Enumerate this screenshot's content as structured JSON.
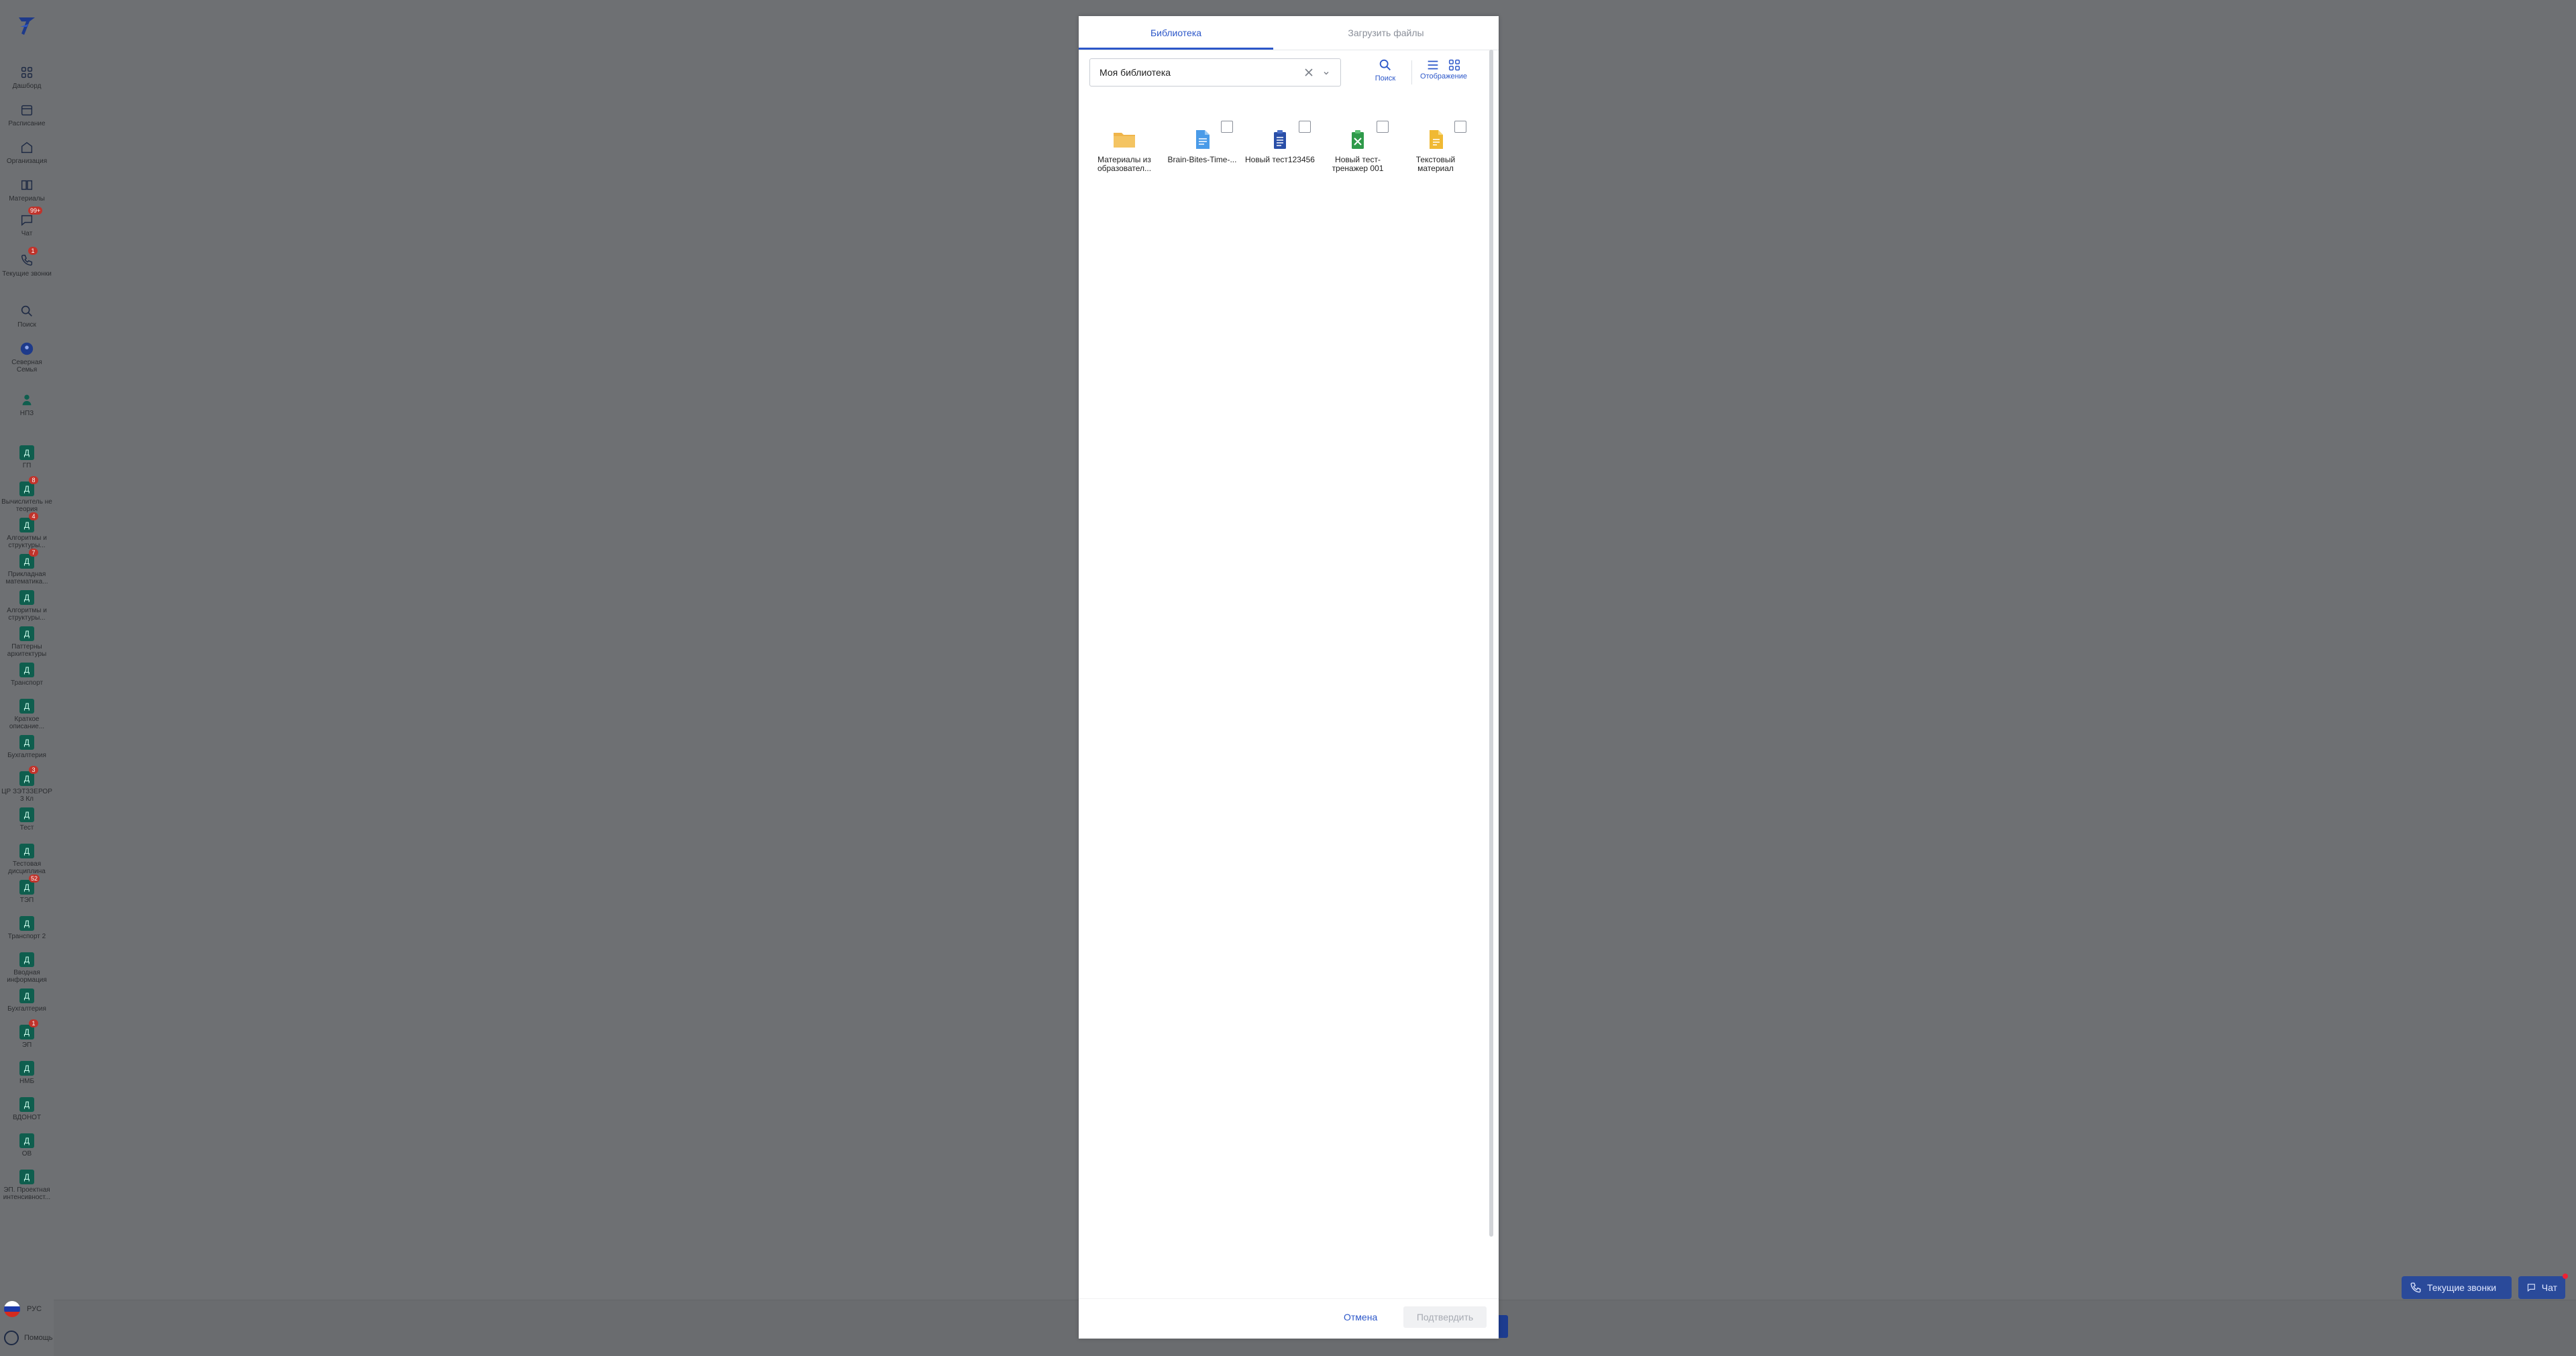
{
  "sidebar": {
    "items": [
      {
        "label": "Дашборд",
        "icon": "dashboard-icon"
      },
      {
        "label": "Расписание",
        "icon": "calendar-icon"
      },
      {
        "label": "Организация",
        "icon": "organization-icon"
      },
      {
        "label": "Материалы",
        "icon": "book-icon"
      },
      {
        "label": "Чат",
        "icon": "chat-icon",
        "badge": "99+"
      },
      {
        "label": "Текущие звонки",
        "icon": "phone-icon",
        "badge": "1"
      },
      {
        "label": "Поиск",
        "icon": "search-icon"
      },
      {
        "label": "Северная Семья",
        "icon": "group-avatar-icon"
      },
      {
        "label": "НПЗ",
        "icon": "person-icon"
      }
    ],
    "courses": [
      {
        "label": "ГП",
        "badge": ""
      },
      {
        "label": "Вычислитель не теория",
        "badge": "8"
      },
      {
        "label": "Алгоритмы и структуры...",
        "badge": "4"
      },
      {
        "label": "Прикладная математика...",
        "badge": "7"
      },
      {
        "label": "Алгоритмы и структуры...",
        "badge": ""
      },
      {
        "label": "Паттерны архитектуры",
        "badge": ""
      },
      {
        "label": "Транспорт",
        "badge": ""
      },
      {
        "label": "Краткое описание...",
        "badge": ""
      },
      {
        "label": "Бухгалтерия",
        "badge": ""
      },
      {
        "label": "ЦР ЗЭТЗЗЕРОР 3 Кл",
        "badge": "3"
      },
      {
        "label": "Тест",
        "badge": ""
      },
      {
        "label": "Тестовая дисциплина",
        "badge": ""
      },
      {
        "label": "ТЭП",
        "badge": "52"
      },
      {
        "label": "Транспорт 2",
        "badge": ""
      },
      {
        "label": "Вводная информация",
        "badge": ""
      },
      {
        "label": "Бухгалтерия",
        "badge": ""
      },
      {
        "label": "ЭП",
        "badge": "1"
      },
      {
        "label": "НМБ",
        "badge": ""
      },
      {
        "label": "ВДОНОТ",
        "badge": ""
      },
      {
        "label": "ОВ",
        "badge": ""
      },
      {
        "label": "ЭП. Проектная интенсивност...",
        "badge": ""
      }
    ],
    "lang": "РУС",
    "help": "Помощь"
  },
  "floating": {
    "calls_label": "Текущие звонки",
    "chat_label": "Чат"
  },
  "modal": {
    "tabs": [
      {
        "label": "Библиотека",
        "active": true
      },
      {
        "label": "Загрузить файлы",
        "active": false
      }
    ],
    "library_select": {
      "value": "Моя библиотека"
    },
    "tools": {
      "search_label": "Поиск",
      "view_label": "Отображение"
    },
    "files": [
      {
        "name": "Материалы из образовател...",
        "type": "folder",
        "color": "#f0b54a",
        "checkbox": false
      },
      {
        "name": "Brain-Bites-Time-...",
        "type": "document",
        "color": "#4a9be8",
        "checkbox": true
      },
      {
        "name": "Новый тест123456",
        "type": "test",
        "color": "#2a4fa8",
        "checkbox": true
      },
      {
        "name": "Новый тест-тренажер 001",
        "type": "trainer",
        "color": "#2f9a4a",
        "checkbox": true
      },
      {
        "name": "Текстовый материал",
        "type": "text",
        "color": "#f0b933",
        "checkbox": true
      }
    ],
    "cancel_label": "Отмена",
    "confirm_label": "Подтвердить"
  },
  "colors": {
    "accent": "#2c57c9",
    "overlay": "#6e7073"
  }
}
